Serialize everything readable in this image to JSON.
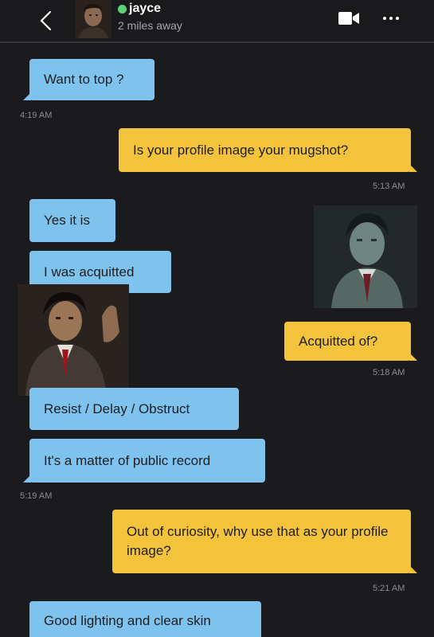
{
  "header": {
    "name": "jayce",
    "distance": "2 miles away",
    "icons": {
      "back": "chevron-left-icon",
      "video": "video-camera-icon",
      "more": "more-dots-icon"
    },
    "online_color": "#5fd17a"
  },
  "messages": [
    {
      "side": "incoming",
      "text": "Want to top ?"
    },
    {
      "timestamp": "4:19 AM"
    },
    {
      "side": "outgoing",
      "text": "Is your profile image your mugshot?"
    },
    {
      "timestamp": "5:13 AM"
    },
    {
      "side": "incoming",
      "text": "Yes it is"
    },
    {
      "side": "incoming",
      "text": "I was acquitted"
    },
    {
      "side": "outgoing",
      "text": "Acquitted of?"
    },
    {
      "timestamp": "5:18 AM"
    },
    {
      "side": "incoming",
      "text": "Resist / Delay / Obstruct"
    },
    {
      "side": "incoming",
      "text": "It's a matter of public record"
    },
    {
      "timestamp": "5:19 AM"
    },
    {
      "side": "outgoing",
      "text": "Out of curiosity, why use that as your profile image?"
    },
    {
      "timestamp": "5:21 AM"
    },
    {
      "side": "incoming",
      "text": "Good lighting and clear skin"
    }
  ],
  "colors": {
    "background": "#1b1b1d",
    "incoming_bubble": "#7ec3ee",
    "outgoing_bubble": "#f3c33c"
  }
}
